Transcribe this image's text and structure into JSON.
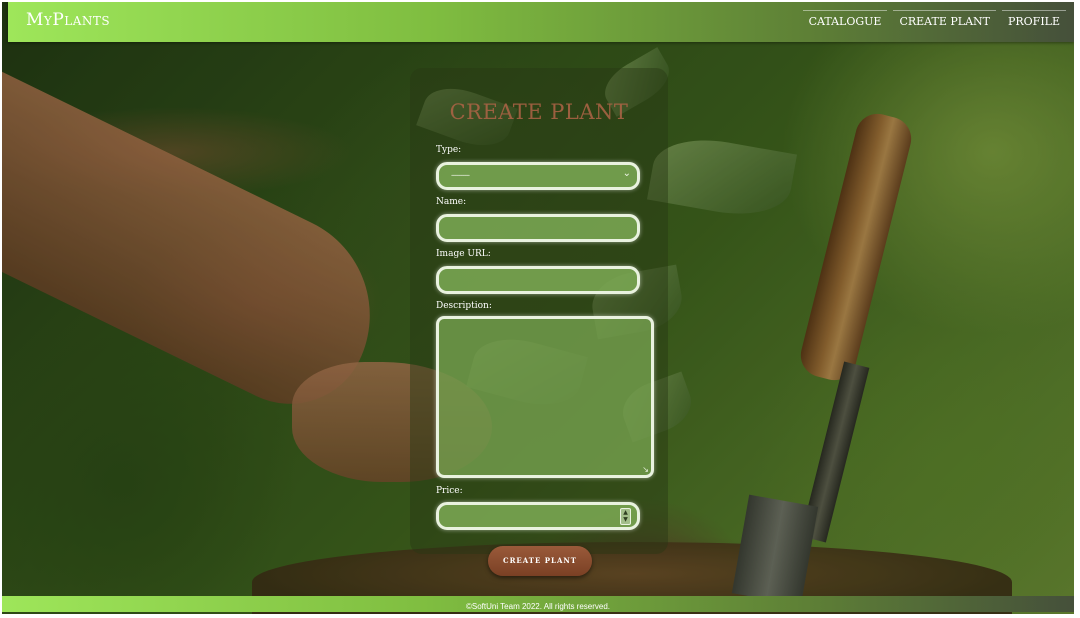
{
  "app": {
    "brand": "MyPlants"
  },
  "nav": {
    "items": [
      {
        "label": "CATALOGUE"
      },
      {
        "label": "CREATE PLANT"
      },
      {
        "label": "PROFILE"
      }
    ]
  },
  "form": {
    "title": "CREATE PLANT",
    "type_label": "Type:",
    "type_value": "---------",
    "name_label": "Name:",
    "image_url_label": "Image URL:",
    "description_label": "Description:",
    "price_label": "Price:",
    "submit_label": "CREATE PLANT"
  },
  "footer": {
    "text": "©SoftUni Team 2022. All rights reserved."
  },
  "colors": {
    "accent": "#8e5a3e",
    "nav_start": "#9ee65a",
    "field_fill": "#7daa55"
  }
}
